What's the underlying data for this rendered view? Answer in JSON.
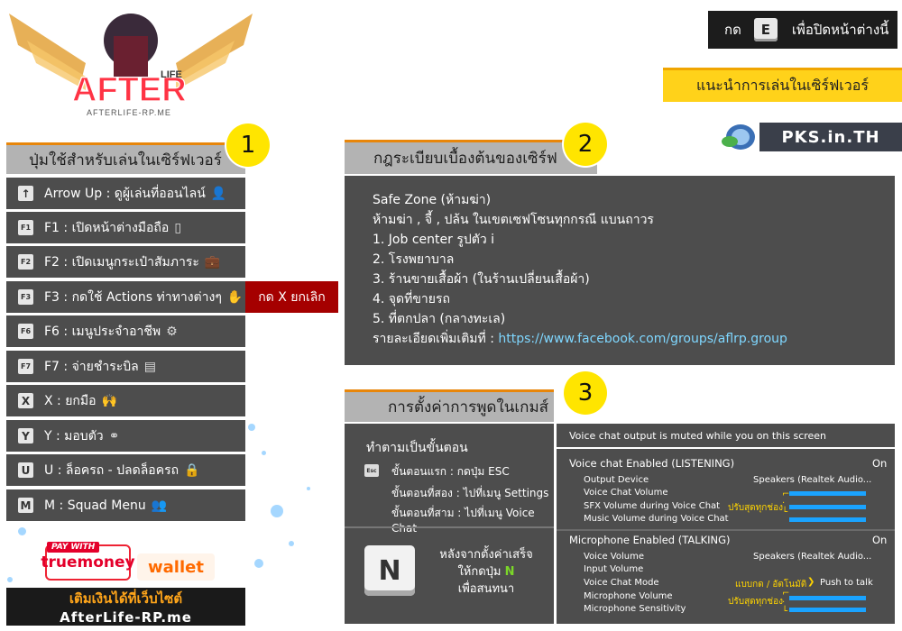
{
  "logo": {
    "text": "AFTER",
    "sub": "LIFE",
    "url": "AFTERLIFE-RP.ME"
  },
  "close_hint": {
    "before": "กด",
    "key": "E",
    "after": "เพื่อปิดหน้าต่างนี้"
  },
  "server_guide": "แนะนำการเล่นในเซิร์ฟเวอร์",
  "pks": "PKS.in.TH",
  "left": {
    "badge": "1",
    "title": "ปุ่มใช้สำหรับเล่นในเซิร์ฟเวอร์",
    "items": [
      {
        "key": "↑",
        "label": "Arrow Up : ดูผู้เล่นที่ออนไลน์",
        "icon": "user-icon"
      },
      {
        "key": "F1",
        "label": "F1 : เปิดหน้าต่างมือถือ",
        "icon": "phone-icon"
      },
      {
        "key": "F2",
        "label": "F2 : เปิดเมนูกระเป๋าสัมภาระ",
        "icon": "briefcase-icon"
      },
      {
        "key": "F3",
        "label": "F3 : กดใช้ Actions ท่าทางต่างๆ",
        "icon": "hand-icon"
      },
      {
        "key": "F6",
        "label": "F6 : เมนูประจำอาชีพ",
        "icon": "tools-icon"
      },
      {
        "key": "F7",
        "label": "F7 : จ่ายชำระบิล",
        "icon": "bill-icon"
      },
      {
        "key": "X",
        "label": "X : ยกมือ",
        "icon": "raise-hands-icon"
      },
      {
        "key": "Y",
        "label": "Y : มอบตัว",
        "icon": "handcuffs-icon"
      },
      {
        "key": "U",
        "label": "U : ล็อครถ - ปลดล็อครถ",
        "icon": "lock-icon"
      },
      {
        "key": "M",
        "label": "M : Squad Menu",
        "icon": "squad-icon"
      }
    ],
    "cancel_hint": "กด X ยกเลิก"
  },
  "payment": {
    "pay_with": "PAY WITH",
    "truemoney": "truemoney",
    "wallet": "wallet",
    "topup": "เติมเงินได้ที่เว็บไซต์",
    "site": "AfterLife-RP.me"
  },
  "rules": {
    "badge": "2",
    "title": "กฎระเบียบเบื้องต้นของเซิร์ฟ",
    "lines": [
      "Safe Zone (ห้ามฆ่า)",
      "ห้ามฆ่า , จี้ , ปล้น ในเขตเซฟโซนทุกกรณี แบนถาวร",
      "1. Job center รูปตัว i",
      "2. โรงพยาบาล",
      "3. ร้านขายเสื้อผ้า (ในร้านเปลี่ยนเสื้อผ้า)",
      "4. จุดที่ขายรถ",
      "5. ที่ตกปลา (กลางทะเล)"
    ],
    "more_label": "รายละเอียดเพิ่มเติมที่ : ",
    "more_link": "https://www.facebook.com/groups/aflrp.group"
  },
  "settings": {
    "badge": "3",
    "title": "การตั้งค่าการพูดในเกมส์",
    "steps_title": "ทำตามเป็นขั้นตอน",
    "esc_key": "Esc",
    "step1": "ขั้นตอนแรก : กดปุ่ม ESC",
    "step2": "ขั้นตอนที่สอง : ไปที่เมนู Settings",
    "step3": "ขั้นตอนที่สาม : ไปที่เมนู Voice Chat",
    "n_key": "N",
    "after1": "หลังจากตั้งค่าเสร็จ",
    "after2_pre": "ให้กดปุ่ม ",
    "after2_key": "N",
    "after3": "เพื่อสนทนา",
    "voice_muted": "Voice chat output is muted while you on this screen",
    "listen_title": "Voice chat Enabled (LISTENING)",
    "listen_state": "On",
    "output_device": "Output Device",
    "output_value": "Speakers (Realtek Audio...",
    "voice_volume": "Voice Chat Volume",
    "sfx_volume": "SFX Volume during Voice Chat",
    "music_volume": "Music Volume during Voice Chat",
    "adjust_all": "ปรับสุดทุกช่อง",
    "mic_title": "Microphone Enabled (TALKING)",
    "mic_state": "On",
    "voice_volume2": "Voice Volume",
    "voice_value2": "Speakers (Realtek Audio...",
    "input_volume": "Input Volume",
    "chat_mode": "Voice Chat Mode",
    "mode_hint": "แบบกด / อัตโนมัติ",
    "mode_value": "Push to talk",
    "mic_volume": "Microphone Volume",
    "mic_sens": "Microphone Sensitivity",
    "adjust_all2": "ปรับสุดทุกช่อง"
  }
}
